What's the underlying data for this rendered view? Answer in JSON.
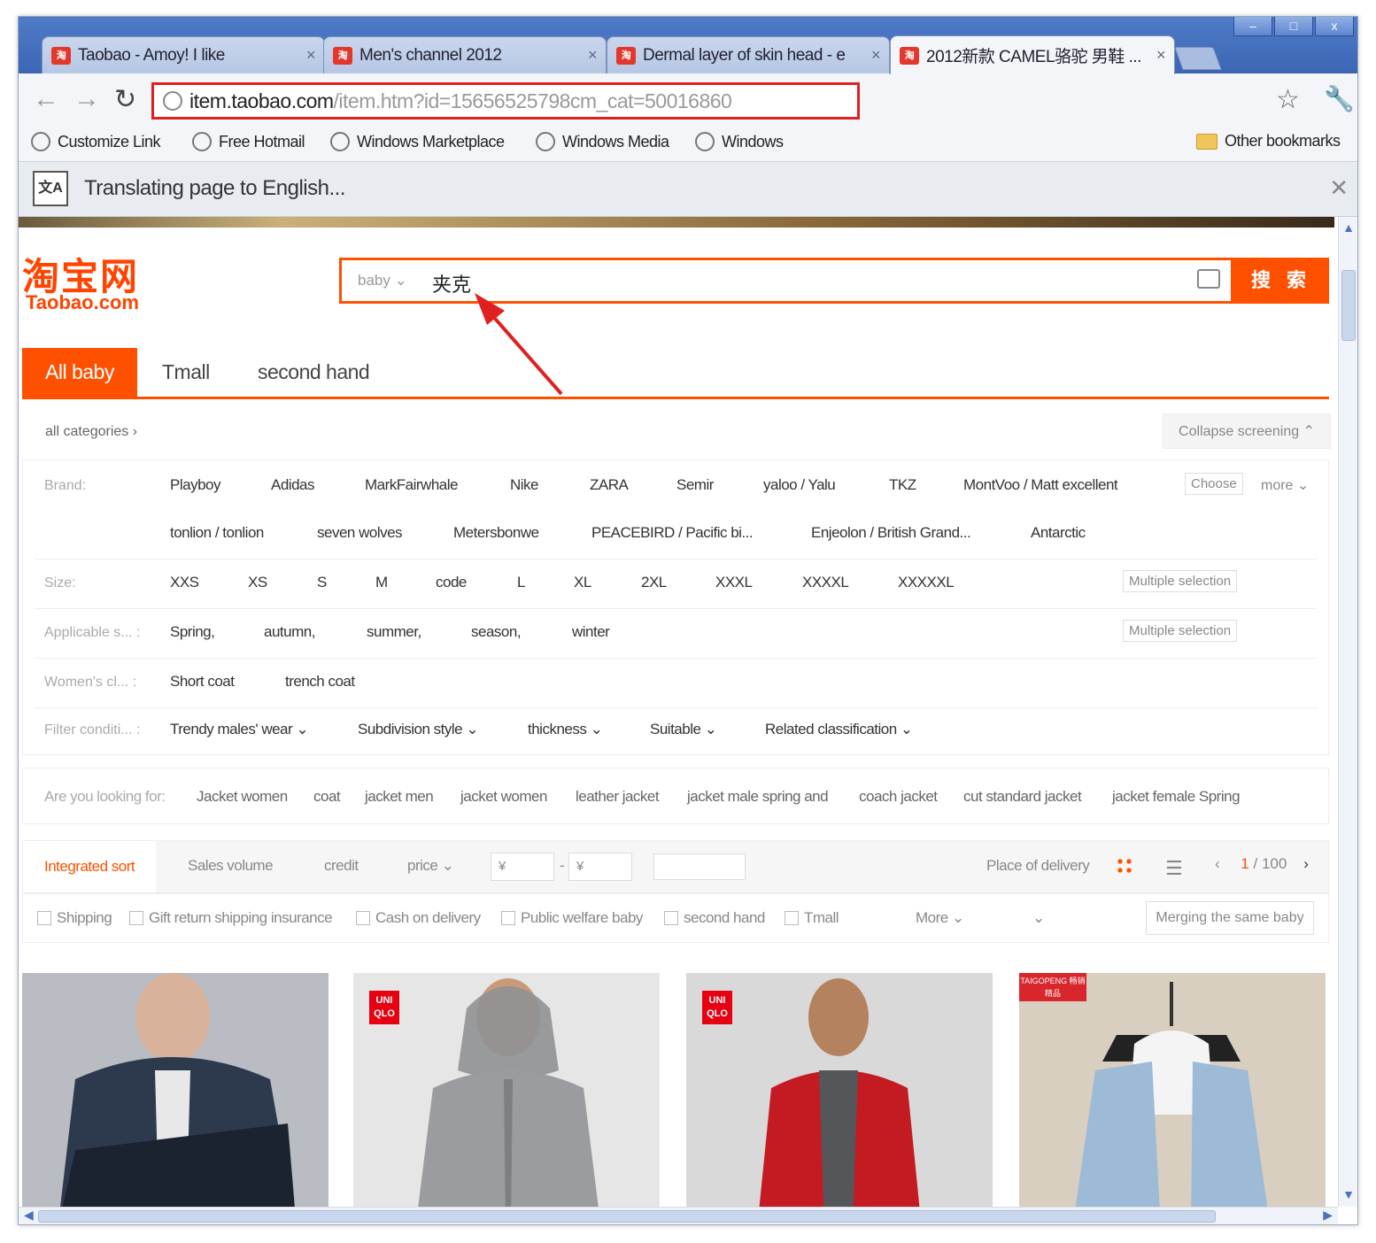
{
  "browser": {
    "tabs": [
      {
        "title": "Taobao - Amoy! I like"
      },
      {
        "title": "Men's channel 2012"
      },
      {
        "title": "Dermal layer of skin head - e"
      },
      {
        "title": "2012新款 CAMEL骆驼 男鞋 ..."
      }
    ],
    "tab_icon_label": "淘",
    "window_controls": {
      "minimize": "–",
      "maximize": "□",
      "close": "x"
    },
    "url_host": "item.taobao.com",
    "url_path": "/item.htm?id=15656525798cm_cat=50016860",
    "bookmarks": [
      "Customize Link",
      "Free Hotmail",
      "Windows Marketplace",
      "Windows Media",
      "Windows"
    ],
    "other_bookmarks": "Other bookmarks",
    "translate_message": "Translating page to English...",
    "translate_icon": "文A"
  },
  "taobao": {
    "logo_cn": "淘宝网",
    "logo_en": "Taobao.com",
    "search_scope": "baby",
    "search_query": "夹克",
    "search_button": "搜 索",
    "tabs": [
      "All baby",
      "Tmall",
      "second hand"
    ],
    "all_categories": "all categories ›",
    "collapse_screening": "Collapse screening ⌃",
    "filters": {
      "brand_label": "Brand:",
      "brands_row1": [
        "Playboy",
        "Adidas",
        "MarkFairwhale",
        "Nike",
        "ZARA",
        "Semir",
        "yaloo / Yalu",
        "TKZ",
        "MontVoo / Matt excellent"
      ],
      "brands_row2": [
        "tonlion / tonlion",
        "seven wolves",
        "Metersbonwe",
        "PEACEBIRD / Pacific bi...",
        "Enjeolon / British Grand...",
        "Antarctic"
      ],
      "choose": "Choose",
      "more": "more ⌄",
      "size_label": "Size:",
      "sizes": [
        "XXS",
        "XS",
        "S",
        "M",
        "code",
        "L",
        "XL",
        "2XL",
        "XXXL",
        "XXXXL",
        "XXXXXL"
      ],
      "multiple_selection": "Multiple selection",
      "season_label": "Applicable s... :",
      "seasons": [
        "Spring,",
        "autumn,",
        "summer,",
        "season,",
        "winter"
      ],
      "women_label": "Women's cl... :",
      "women": [
        "Short coat",
        "trench coat"
      ],
      "filter_label": "Filter conditi... :",
      "conditions": [
        "Trendy males' wear ⌄",
        "Subdivision style ⌄",
        "thickness ⌄",
        "Suitable ⌄",
        "Related classification ⌄"
      ]
    },
    "looking_for_label": "Are you looking for:",
    "looking_for": [
      "Jacket women",
      "coat",
      "jacket men",
      "jacket women",
      "leather jacket",
      "jacket male spring and",
      "coach jacket",
      "cut standard jacket",
      "jacket female Spring"
    ],
    "sort": {
      "integrated": "Integrated sort",
      "sales": "Sales volume",
      "credit": "credit",
      "price": "price ⌄",
      "price_from": "¥",
      "price_to": "¥",
      "price_dash": "-",
      "place": "Place of delivery",
      "page_current": "1",
      "page_total": "/ 100",
      "prev": "‹",
      "next": "›",
      "list_icon": "☰"
    },
    "options": [
      "Shipping",
      "Gift return shipping insurance",
      "Cash on delivery",
      "Public welfare baby",
      "second hand",
      "Tmall"
    ],
    "options_more": "More ⌄",
    "options_dropdown": "⌄",
    "merge": "Merging the same baby",
    "products": [
      {
        "badge": ""
      },
      {
        "badge": "UNI QLO"
      },
      {
        "badge": "UNI QLO"
      },
      {
        "badge": "TAIGOPENG 畅销精品"
      }
    ]
  },
  "colors": {
    "accent": "#ff5000",
    "highlight": "#e02020"
  }
}
